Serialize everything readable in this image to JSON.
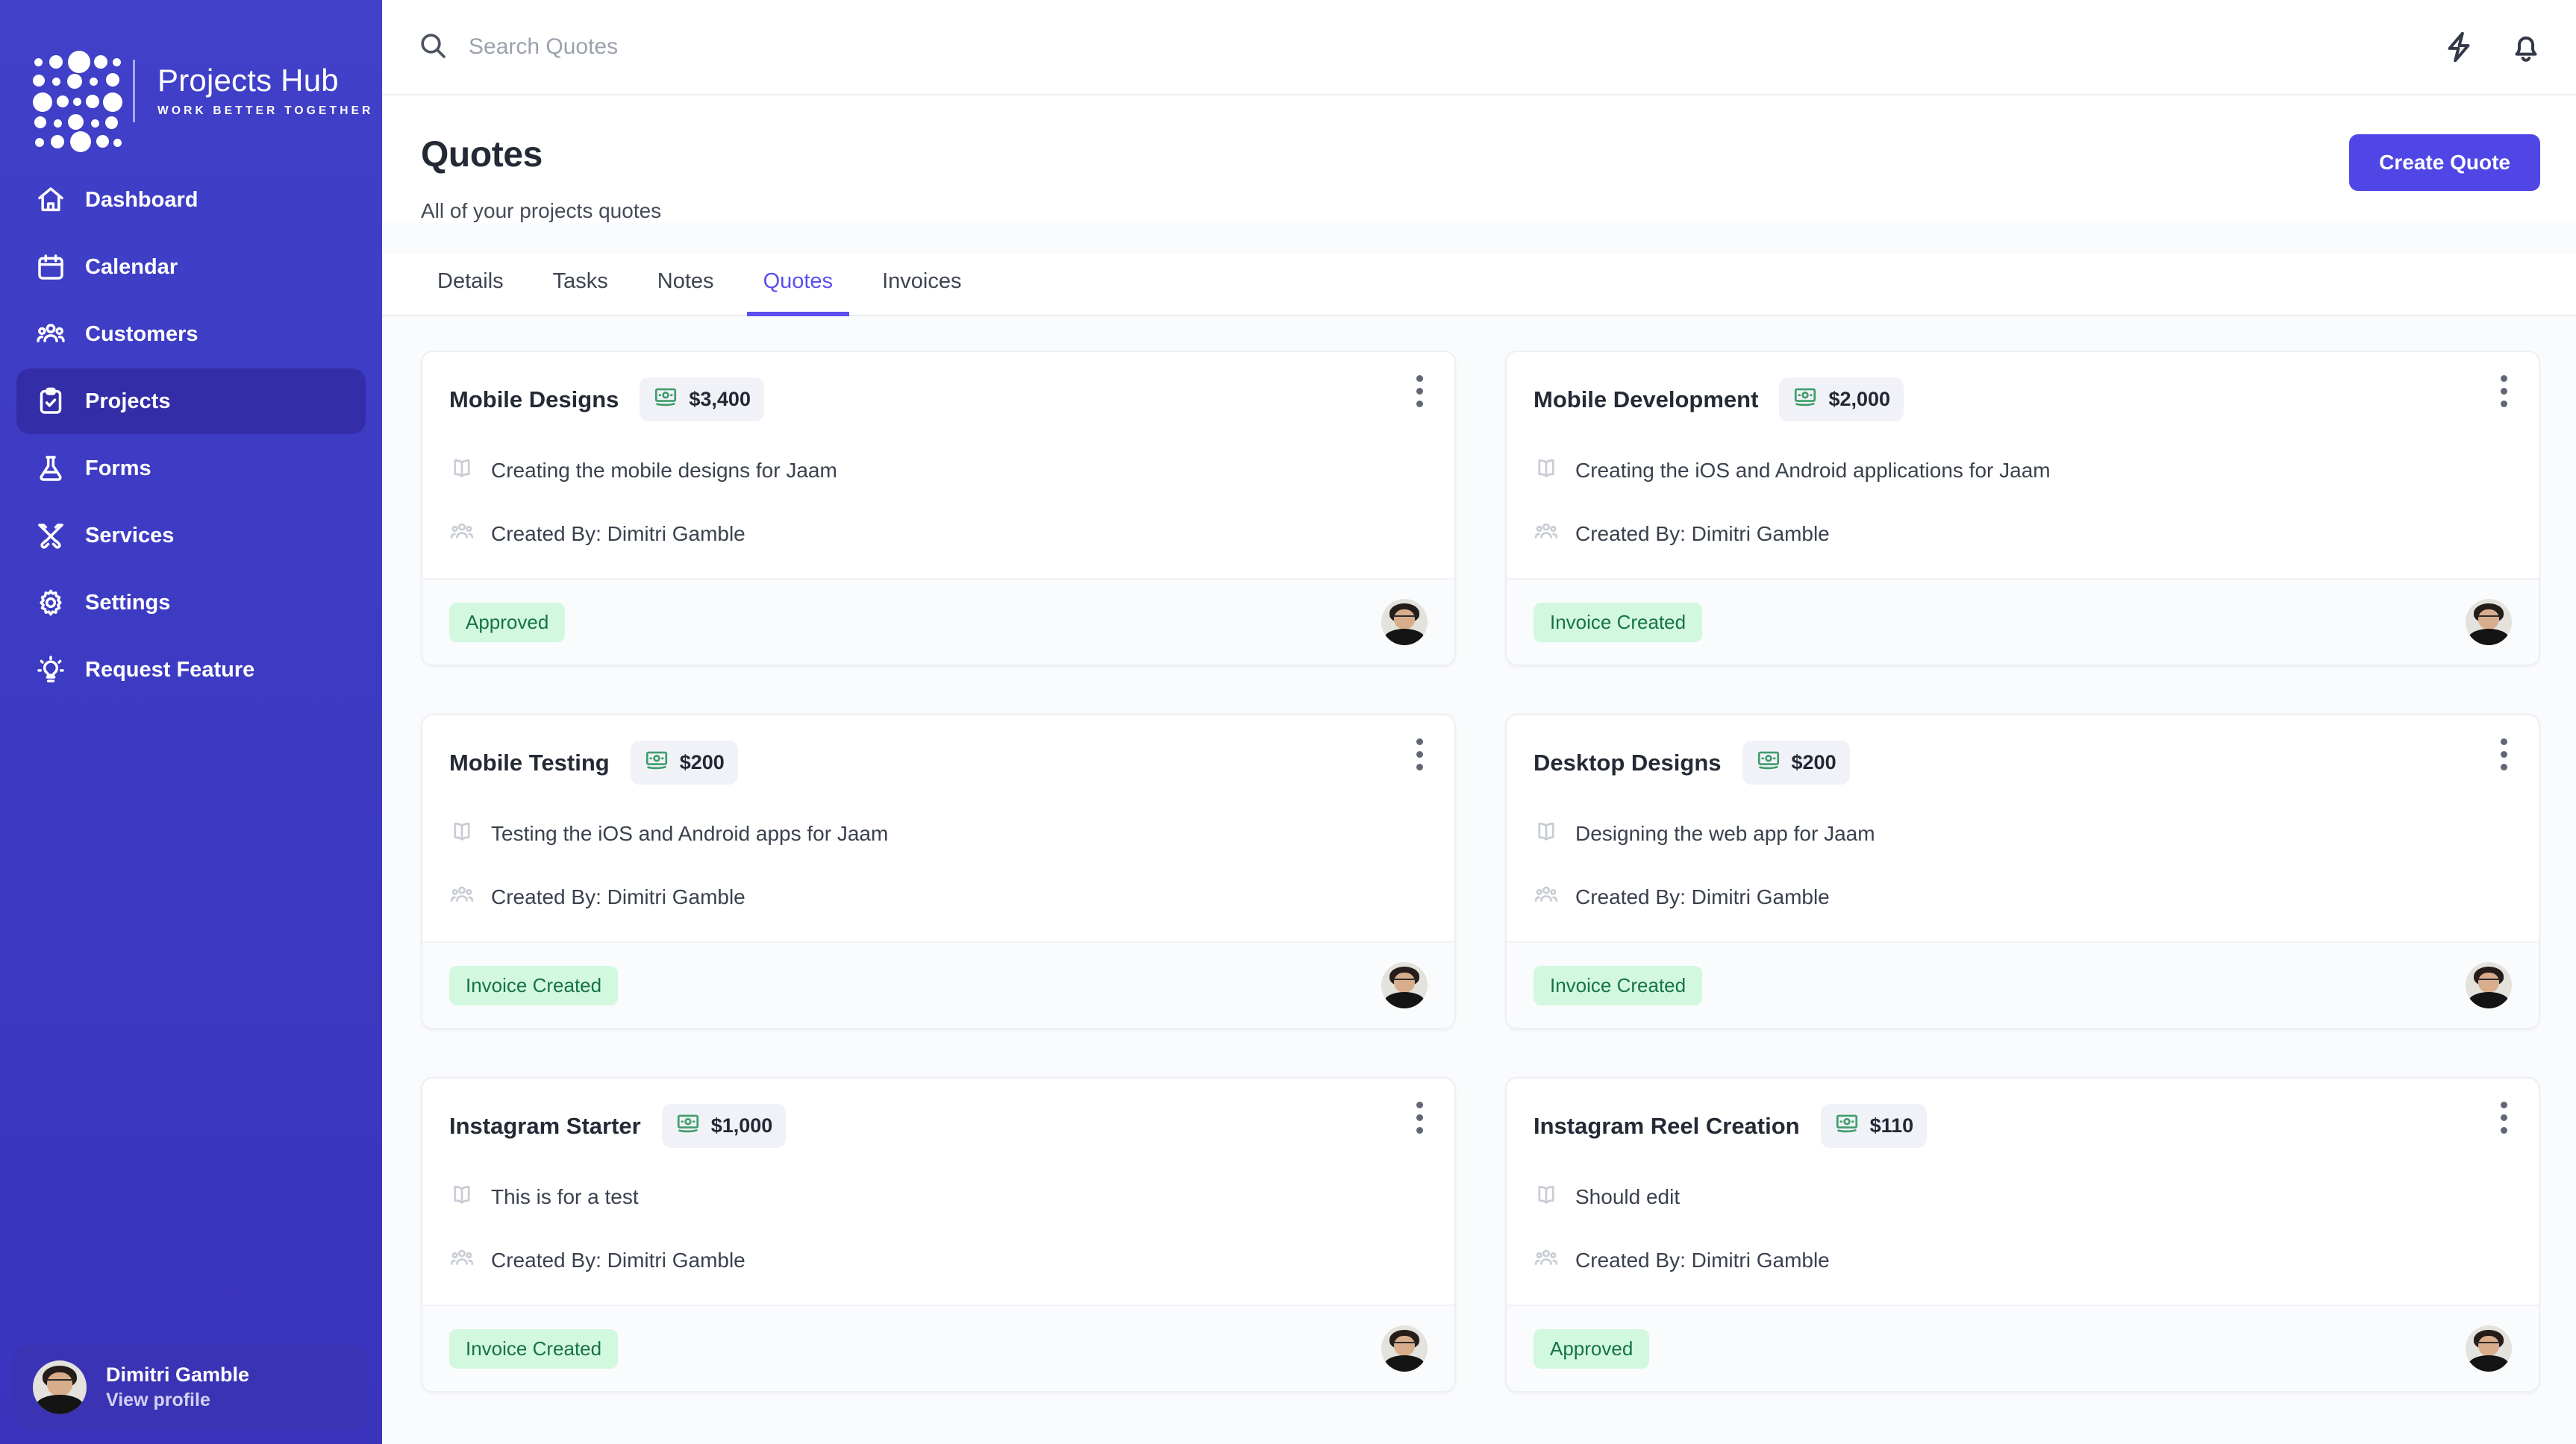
{
  "brand": {
    "title": "Projects Hub",
    "tagline": "WORK BETTER TOGETHER",
    "logo_icon": "dot-matrix-logo",
    "bg_color": "#3f3fc4"
  },
  "sidebar": {
    "items": [
      {
        "label": "Dashboard",
        "icon": "home-icon",
        "active": false
      },
      {
        "label": "Calendar",
        "icon": "calendar-icon",
        "active": false
      },
      {
        "label": "Customers",
        "icon": "users-icon",
        "active": false
      },
      {
        "label": "Projects",
        "icon": "clipboard-check-icon",
        "active": true
      },
      {
        "label": "Forms",
        "icon": "flask-icon",
        "active": false
      },
      {
        "label": "Services",
        "icon": "tools-cross-icon",
        "active": false
      },
      {
        "label": "Settings",
        "icon": "gear-icon",
        "active": false
      },
      {
        "label": "Request Feature",
        "icon": "lightbulb-icon",
        "active": false
      }
    ],
    "profile": {
      "name": "Dimitri Gamble",
      "link_label": "View profile",
      "avatar_icon": "user-avatar"
    }
  },
  "topbar": {
    "search": {
      "placeholder": "Search Quotes",
      "value": "",
      "icon": "search-icon"
    },
    "icons": [
      {
        "name": "lightning-bolt-icon"
      },
      {
        "name": "bell-icon"
      }
    ]
  },
  "page": {
    "title": "Quotes",
    "subtitle": "All of your projects quotes",
    "create_button": "Create Quote",
    "accent_color": "#4f46e5"
  },
  "tabs": [
    {
      "label": "Details",
      "active": false
    },
    {
      "label": "Tasks",
      "active": false
    },
    {
      "label": "Notes",
      "active": false
    },
    {
      "label": "Quotes",
      "active": true
    },
    {
      "label": "Invoices",
      "active": false
    }
  ],
  "quotes": [
    {
      "title": "Mobile Designs",
      "price": "$3,400",
      "description": "Creating the mobile designs for Jaam",
      "created_by": "Created By: Dimitri Gamble",
      "status": "Approved"
    },
    {
      "title": "Mobile Development",
      "price": "$2,000",
      "description": "Creating the iOS and Android applications for Jaam",
      "created_by": "Created By: Dimitri Gamble",
      "status": "Invoice Created"
    },
    {
      "title": "Mobile Testing",
      "price": "$200",
      "description": "Testing the iOS and Android apps for Jaam",
      "created_by": "Created By: Dimitri Gamble",
      "status": "Invoice Created"
    },
    {
      "title": "Desktop Designs",
      "price": "$200",
      "description": "Designing the web app for Jaam",
      "created_by": "Created By: Dimitri Gamble",
      "status": "Invoice Created"
    },
    {
      "title": "Instagram Starter",
      "price": "$1,000",
      "description": "This is for a test",
      "created_by": "Created By: Dimitri Gamble",
      "status": "Invoice Created"
    },
    {
      "title": "Instagram Reel Creation",
      "price": "$110",
      "description": "Should edit",
      "created_by": "Created By: Dimitri Gamble",
      "status": "Approved"
    }
  ],
  "card_icons": {
    "price": "money-bill-icon",
    "description": "book-icon",
    "author": "users-icon",
    "menu": "kebab-menu-icon",
    "avatar": "user-avatar"
  },
  "colors": {
    "badge_bg": "#d3f8e0",
    "badge_text": "#157347",
    "money_icon": "#3f9d6b",
    "tab_active": "#5b4ff0"
  }
}
